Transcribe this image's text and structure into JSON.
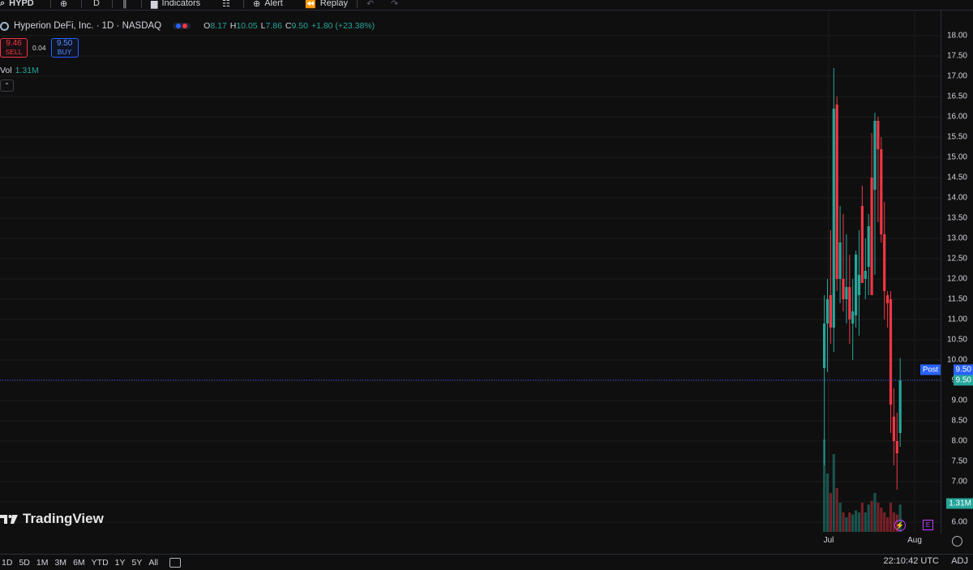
{
  "toolbar": {
    "symbol": "HYPD",
    "interval": "D",
    "indicators_label": "Indicators",
    "alert_label": "Alert",
    "replay_label": "Replay"
  },
  "legend": {
    "title": "Hyperion DeFi, Inc. · 1D · NASDAQ",
    "o_key": "O",
    "o_val": "8.17",
    "h_key": "H",
    "h_val": "10.05",
    "l_key": "L",
    "l_val": "7.86",
    "c_key": "C",
    "c_val": "9.50",
    "change": "+1.80 (+23.38%)"
  },
  "trade": {
    "sell_price": "9.46",
    "sell_label": "SELL",
    "spread": "0.04",
    "buy_price": "9.50",
    "buy_label": "BUY"
  },
  "volume": {
    "label": "Vol",
    "value": "1.31M"
  },
  "branding": {
    "logo_text": "TradingView"
  },
  "colors": {
    "up": "#26a69a",
    "down": "#f23645",
    "accent": "#2962ff",
    "events": "#c040ff"
  },
  "chart_data": {
    "type": "candlestick",
    "ylim": [
      5.75,
      18.25
    ],
    "yticks": [
      "18.00",
      "17.50",
      "17.00",
      "16.50",
      "16.00",
      "15.50",
      "15.00",
      "14.50",
      "14.00",
      "13.50",
      "13.00",
      "12.50",
      "12.00",
      "11.50",
      "11.00",
      "10.50",
      "10.00",
      "9.50",
      "9.00",
      "8.50",
      "8.00",
      "7.50",
      "7.00",
      "6.50",
      "6.00"
    ],
    "xlabels": [
      "Jul",
      "Aug"
    ],
    "last_price": "9.50",
    "post_label": "Post",
    "post_price": "9.50",
    "volume_badge": "1.31M",
    "candles": [
      {
        "o": 9.8,
        "h": 11.6,
        "l": 7.4,
        "c": 10.9,
        "v": 0.95
      },
      {
        "o": 10.9,
        "h": 12.0,
        "l": 9.7,
        "c": 11.5,
        "v": 0.6
      },
      {
        "o": 11.6,
        "h": 13.2,
        "l": 10.4,
        "c": 10.8,
        "v": 0.4
      },
      {
        "o": 10.8,
        "h": 17.2,
        "l": 10.2,
        "c": 16.2,
        "v": 0.8
      },
      {
        "o": 16.3,
        "h": 16.5,
        "l": 11.7,
        "c": 12.0,
        "v": 0.45
      },
      {
        "o": 12.0,
        "h": 13.8,
        "l": 11.4,
        "c": 12.9,
        "v": 0.3
      },
      {
        "o": 12.0,
        "h": 13.6,
        "l": 11.2,
        "c": 11.5,
        "v": 0.2
      },
      {
        "o": 11.5,
        "h": 13.1,
        "l": 10.9,
        "c": 11.8,
        "v": 0.15
      },
      {
        "o": 11.8,
        "h": 12.6,
        "l": 10.4,
        "c": 11.0,
        "v": 0.2
      },
      {
        "o": 10.9,
        "h": 12.0,
        "l": 10.0,
        "c": 11.2,
        "v": 0.18
      },
      {
        "o": 11.1,
        "h": 12.7,
        "l": 10.8,
        "c": 12.6,
        "v": 0.22
      },
      {
        "o": 11.6,
        "h": 13.2,
        "l": 10.6,
        "c": 12.1,
        "v": 0.2
      },
      {
        "o": 13.8,
        "h": 14.3,
        "l": 11.9,
        "c": 11.9,
        "v": 0.3
      },
      {
        "o": 12.0,
        "h": 13.0,
        "l": 11.5,
        "c": 12.2,
        "v": 0.2
      },
      {
        "o": 12.3,
        "h": 13.6,
        "l": 11.6,
        "c": 13.3,
        "v": 0.28
      },
      {
        "o": 14.5,
        "h": 15.6,
        "l": 11.6,
        "c": 11.6,
        "v": 0.32
      },
      {
        "o": 14.2,
        "h": 16.1,
        "l": 12.1,
        "c": 15.9,
        "v": 0.4
      },
      {
        "o": 15.9,
        "h": 16.0,
        "l": 13.4,
        "c": 15.2,
        "v": 0.3
      },
      {
        "o": 15.2,
        "h": 15.5,
        "l": 12.9,
        "c": 13.1,
        "v": 0.25
      },
      {
        "o": 13.1,
        "h": 13.9,
        "l": 11.0,
        "c": 11.7,
        "v": 0.2
      },
      {
        "o": 11.6,
        "h": 11.7,
        "l": 10.8,
        "c": 11.4,
        "v": 0.15
      },
      {
        "o": 11.5,
        "h": 11.7,
        "l": 8.2,
        "c": 8.9,
        "v": 0.3
      },
      {
        "o": 8.6,
        "h": 9.3,
        "l": 7.4,
        "c": 8.0,
        "v": 0.2
      },
      {
        "o": 8.0,
        "h": 8.7,
        "l": 6.8,
        "c": 7.7,
        "v": 0.18
      },
      {
        "o": 8.2,
        "h": 10.05,
        "l": 7.86,
        "c": 9.5,
        "v": 0.28
      }
    ]
  }
}
